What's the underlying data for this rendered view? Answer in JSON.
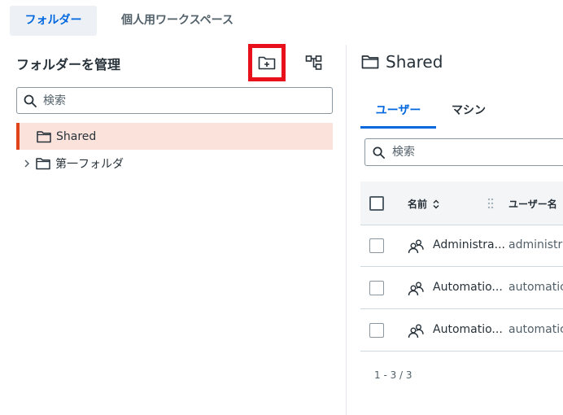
{
  "top_tabs": [
    {
      "label": "フォルダー",
      "active": true
    },
    {
      "label": "個人用ワークスペース",
      "active": false
    }
  ],
  "left_panel": {
    "title": "フォルダーを管理",
    "search_placeholder": "検索",
    "tree": [
      {
        "label": "Shared",
        "selected": true,
        "expandable": false
      },
      {
        "label": "第一フォルダ",
        "selected": false,
        "expandable": true
      }
    ],
    "icons": {
      "new_folder": "folder-plus-icon",
      "tree_view": "tree-structure-icon"
    },
    "highlight_color": "#e8101a"
  },
  "right_panel": {
    "title": "Shared",
    "tabs": [
      {
        "label": "ユーザー",
        "active": true
      },
      {
        "label": "マシン",
        "active": false
      }
    ],
    "search_placeholder": "検索",
    "grid": {
      "columns": [
        "名前",
        "ユーザー名"
      ],
      "rows": [
        {
          "name": "Administra...",
          "username": "administra"
        },
        {
          "name": "Automatio...",
          "username": "automatic"
        },
        {
          "name": "Automatio...",
          "username": "automatic"
        }
      ]
    },
    "pager": "1 - 3 / 3"
  },
  "colors": {
    "accent": "#0067df",
    "selected_bg": "#fbe3dc",
    "selected_border": "#e0441b"
  }
}
